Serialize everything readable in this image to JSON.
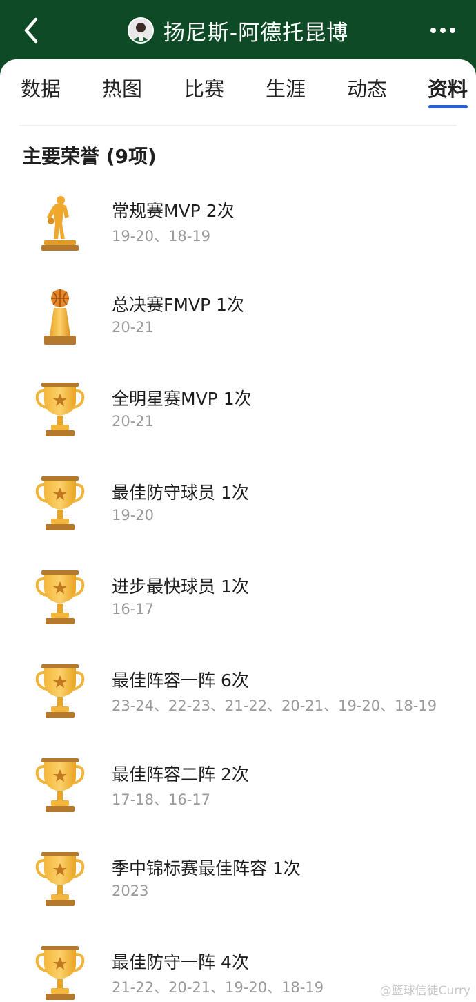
{
  "header": {
    "title": "扬尼斯-阿德托昆博",
    "back_icon": "chevron-left-icon",
    "more_icon": "more-dots-icon",
    "background_color": "#0e4a25"
  },
  "tabs": [
    {
      "label": "数据"
    },
    {
      "label": "热图"
    },
    {
      "label": "比赛"
    },
    {
      "label": "生涯"
    },
    {
      "label": "动态"
    },
    {
      "label": "资料",
      "active": true
    }
  ],
  "accent_color": "#2f5fd8",
  "section": {
    "title": "主要荣誉 (9项)"
  },
  "honors": [
    {
      "name": "常规赛MVP 2次",
      "years": "19-20、18-19",
      "icon": "mvp-trophy-icon"
    },
    {
      "name": "总决赛FMVP 1次",
      "years": "20-21",
      "icon": "finals-trophy-icon"
    },
    {
      "name": "全明星赛MVP 1次",
      "years": "20-21",
      "icon": "trophy-icon"
    },
    {
      "name": "最佳防守球员 1次",
      "years": "19-20",
      "icon": "trophy-icon"
    },
    {
      "name": "进步最快球员 1次",
      "years": "16-17",
      "icon": "trophy-icon"
    },
    {
      "name": "最佳阵容一阵 6次",
      "years": "23-24、22-23、21-22、20-21、19-20、18-19",
      "icon": "trophy-icon"
    },
    {
      "name": "最佳阵容二阵 2次",
      "years": "17-18、16-17",
      "icon": "trophy-icon"
    },
    {
      "name": "季中锦标赛最佳阵容 1次",
      "years": "2023",
      "icon": "trophy-icon"
    },
    {
      "name": "最佳防守一阵 4次",
      "years": "21-22、20-21、19-20、18-19",
      "icon": "trophy-icon"
    }
  ],
  "watermark": "@篮球信徒Curry"
}
